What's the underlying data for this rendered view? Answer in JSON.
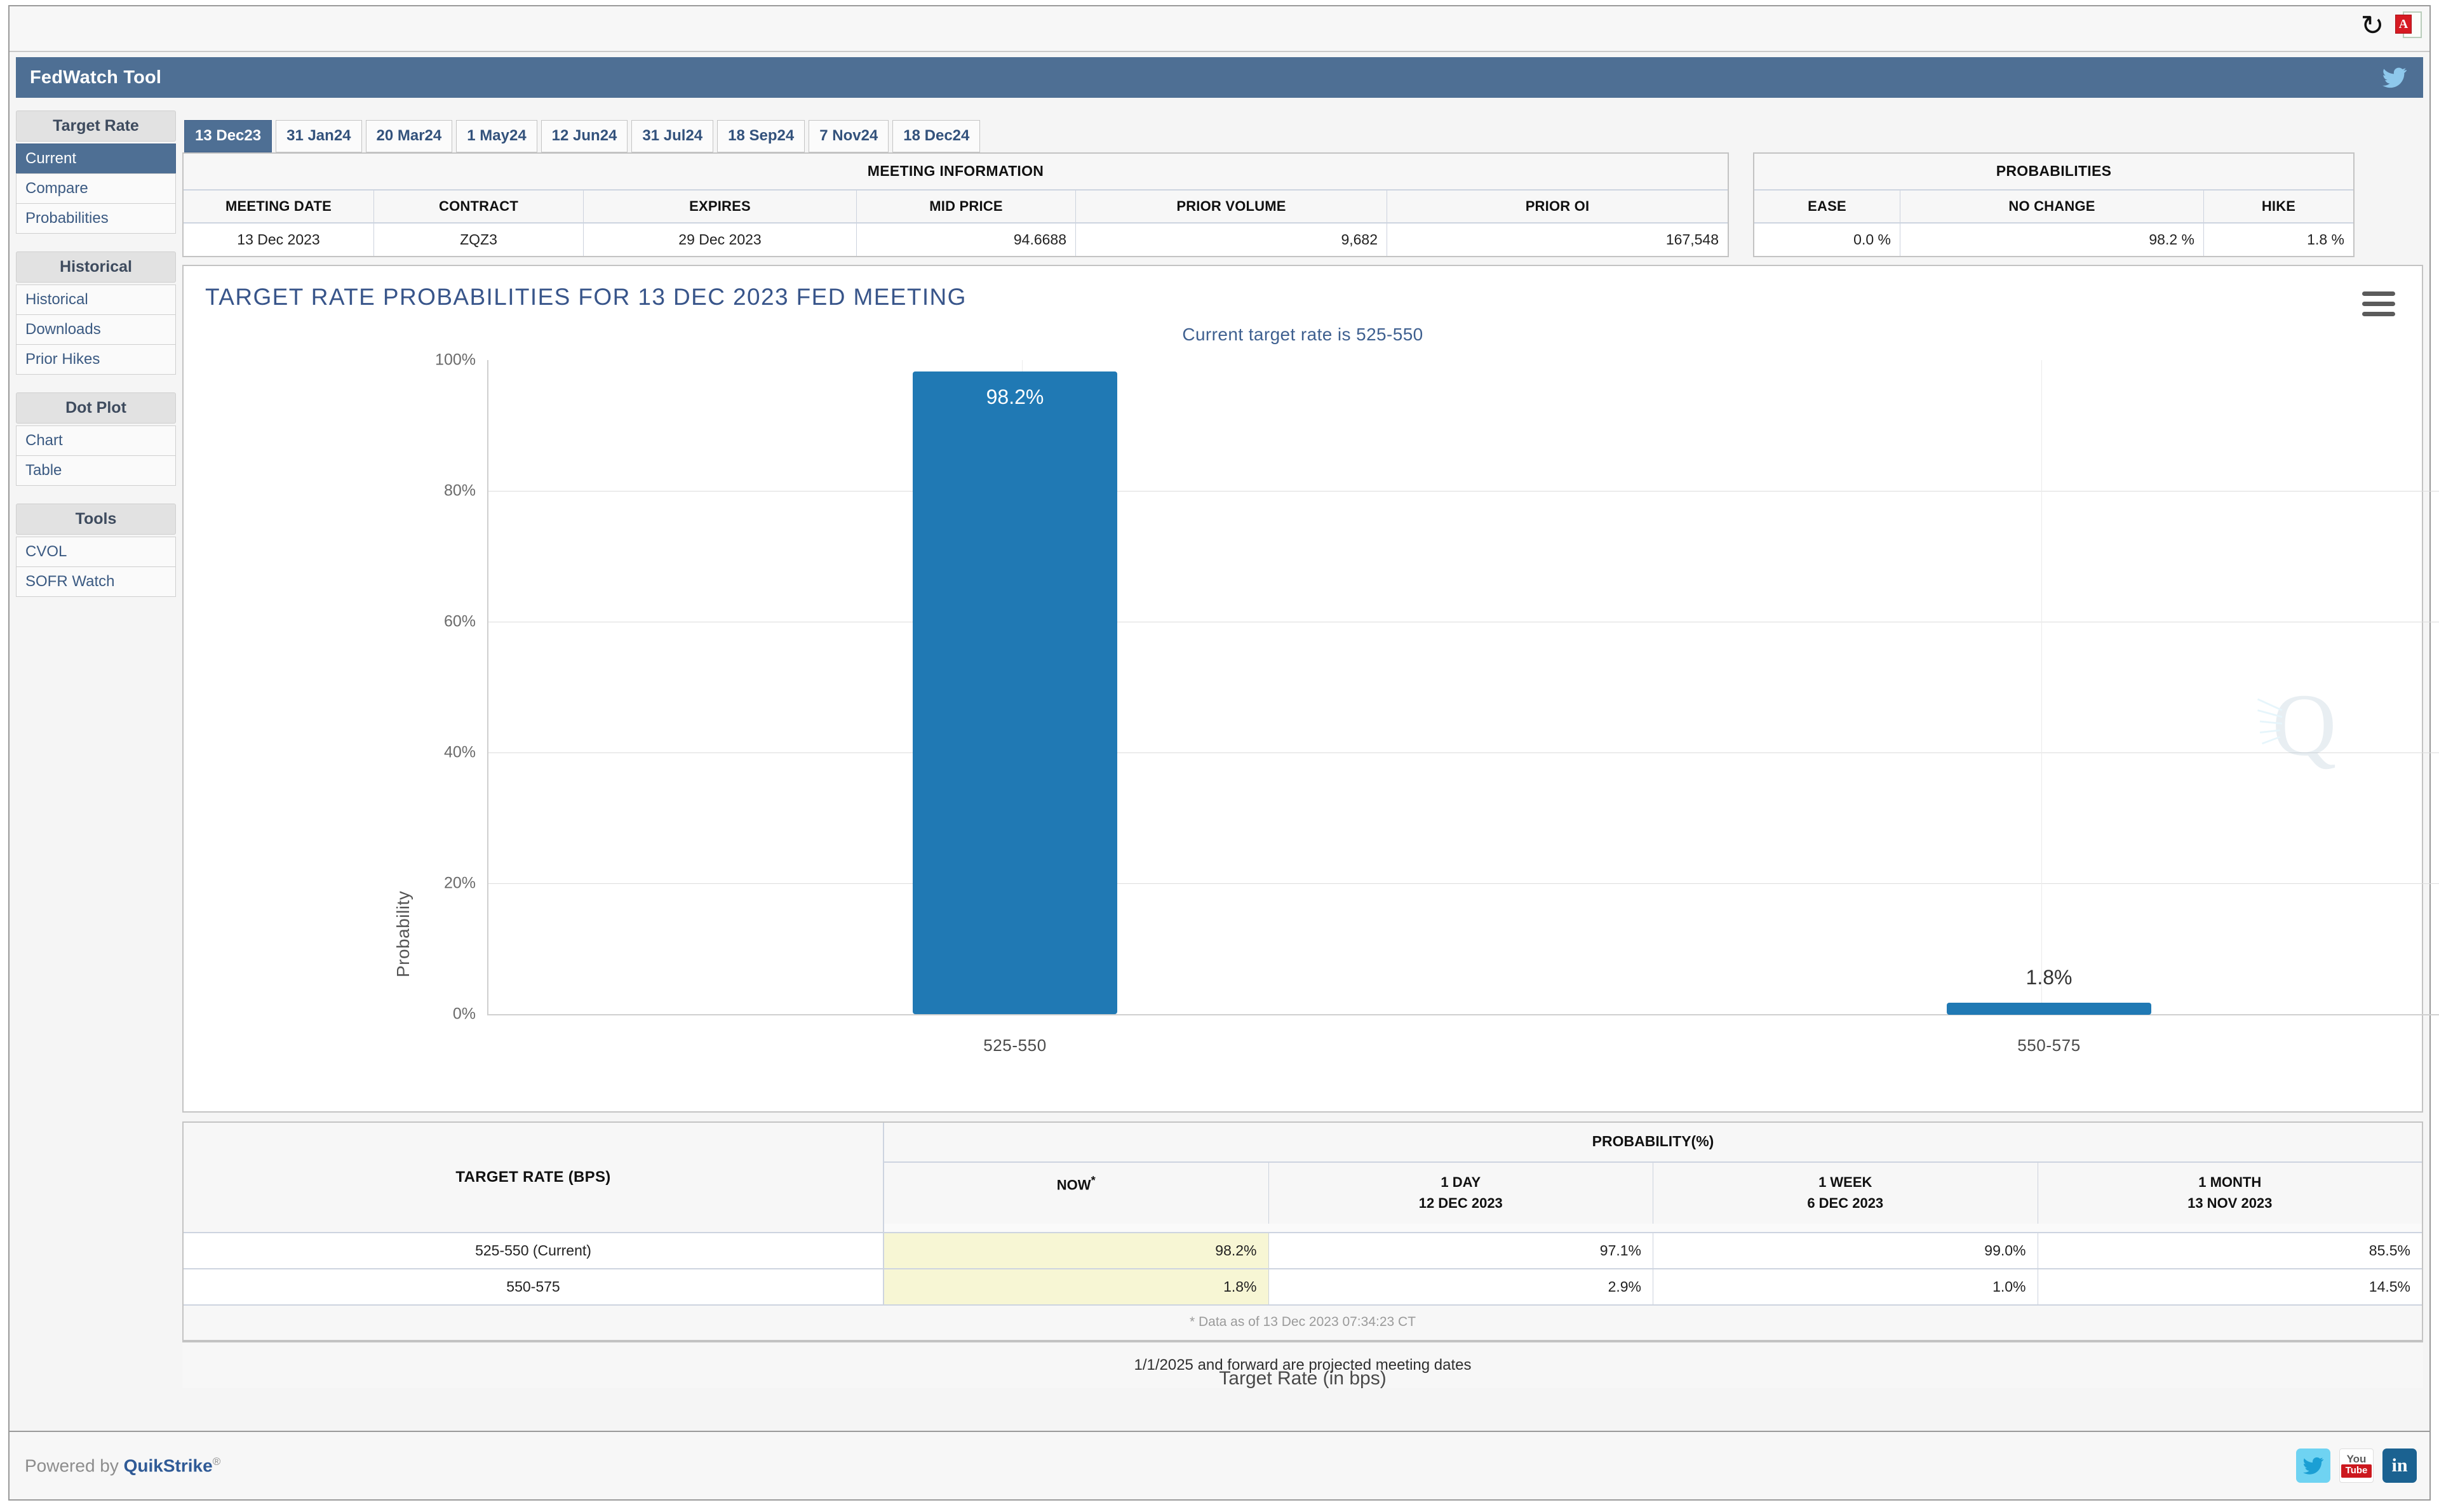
{
  "window": {
    "title": "FedWatch Tool",
    "refresh_icon": "refresh-icon",
    "pdf_icon": "pdf-icon",
    "pdf_badge": "A",
    "twitter_icon": "twitter-icon"
  },
  "sidebar": {
    "groups": [
      {
        "header": "Target Rate",
        "items": [
          {
            "label": "Current",
            "active": true
          },
          {
            "label": "Compare",
            "active": false
          },
          {
            "label": "Probabilities",
            "active": false
          }
        ]
      },
      {
        "header": "Historical",
        "items": [
          {
            "label": "Historical",
            "active": false
          },
          {
            "label": "Downloads",
            "active": false
          },
          {
            "label": "Prior Hikes",
            "active": false
          }
        ]
      },
      {
        "header": "Dot Plot",
        "items": [
          {
            "label": "Chart",
            "active": false
          },
          {
            "label": "Table",
            "active": false
          }
        ]
      },
      {
        "header": "Tools",
        "items": [
          {
            "label": "CVOL",
            "active": false
          },
          {
            "label": "SOFR Watch",
            "active": false
          }
        ]
      }
    ]
  },
  "tabs": [
    {
      "label": "13 Dec23",
      "active": true
    },
    {
      "label": "31 Jan24",
      "active": false
    },
    {
      "label": "20 Mar24",
      "active": false
    },
    {
      "label": "1 May24",
      "active": false
    },
    {
      "label": "12 Jun24",
      "active": false
    },
    {
      "label": "31 Jul24",
      "active": false
    },
    {
      "label": "18 Sep24",
      "active": false
    },
    {
      "label": "7 Nov24",
      "active": false
    },
    {
      "label": "18 Dec24",
      "active": false
    }
  ],
  "meeting_information": {
    "group_header": "MEETING INFORMATION",
    "columns": [
      "MEETING DATE",
      "CONTRACT",
      "EXPIRES",
      "MID PRICE",
      "PRIOR VOLUME",
      "PRIOR OI"
    ],
    "values": [
      "13 Dec 2023",
      "ZQZ3",
      "29 Dec 2023",
      "94.6688",
      "9,682",
      "167,548"
    ]
  },
  "probabilities_summary": {
    "group_header": "PROBABILITIES",
    "columns": [
      "EASE",
      "NO CHANGE",
      "HIKE"
    ],
    "values": [
      "0.0 %",
      "98.2 %",
      "1.8 %"
    ]
  },
  "chart_panel": {
    "menu_icon": "hamburger-menu-icon",
    "watermark": "quikstrike-watermark"
  },
  "chart_data": {
    "type": "bar",
    "title": "TARGET RATE PROBABILITIES FOR 13 DEC 2023 FED MEETING",
    "subtitle": "Current target rate is 525-550",
    "categories": [
      "525-550",
      "550-575"
    ],
    "values": [
      98.2,
      1.8
    ],
    "data_labels": [
      "98.2%",
      "1.8%"
    ],
    "xlabel": "Target Rate (in bps)",
    "ylabel": "Probability",
    "ylim": [
      0,
      100
    ],
    "yticks": [
      0,
      20,
      40,
      60,
      80,
      100
    ],
    "ytick_labels": [
      "0%",
      "20%",
      "40%",
      "60%",
      "80%",
      "100%"
    ],
    "grid": true,
    "legend": "none",
    "bar_color": "#2079b4"
  },
  "probability_table": {
    "left_header": "TARGET RATE (BPS)",
    "group_header": "PROBABILITY(%)",
    "columns": [
      {
        "line1": "NOW",
        "line2": "*",
        "now": true
      },
      {
        "line1": "1 DAY",
        "line2": "12 DEC 2023",
        "now": false
      },
      {
        "line1": "1 WEEK",
        "line2": "6 DEC 2023",
        "now": false
      },
      {
        "line1": "1 MONTH",
        "line2": "13 NOV 2023",
        "now": false
      }
    ],
    "rows": [
      {
        "rate": "525-550 (Current)",
        "values": [
          "98.2%",
          "97.1%",
          "99.0%",
          "85.5%"
        ]
      },
      {
        "rate": "550-575",
        "values": [
          "1.8%",
          "2.9%",
          "1.0%",
          "14.5%"
        ]
      }
    ],
    "note": "* Data as of 13 Dec 2023 07:34:23 CT"
  },
  "projected_note": "1/1/2025 and forward are projected meeting dates",
  "footer": {
    "powered_prefix": "Powered by ",
    "powered_brand": "QuikStrike",
    "powered_sup": "®",
    "social": [
      {
        "name": "twitter-icon",
        "label": "t"
      },
      {
        "name": "youtube-icon",
        "label_top": "You",
        "label_bottom": "Tube"
      },
      {
        "name": "linkedin-icon",
        "label": "in"
      }
    ]
  },
  "colors": {
    "accent": "#4e6f94",
    "bar": "#2079b4",
    "title_text": "#38558a",
    "now_highlight": "#f7f6d4"
  }
}
